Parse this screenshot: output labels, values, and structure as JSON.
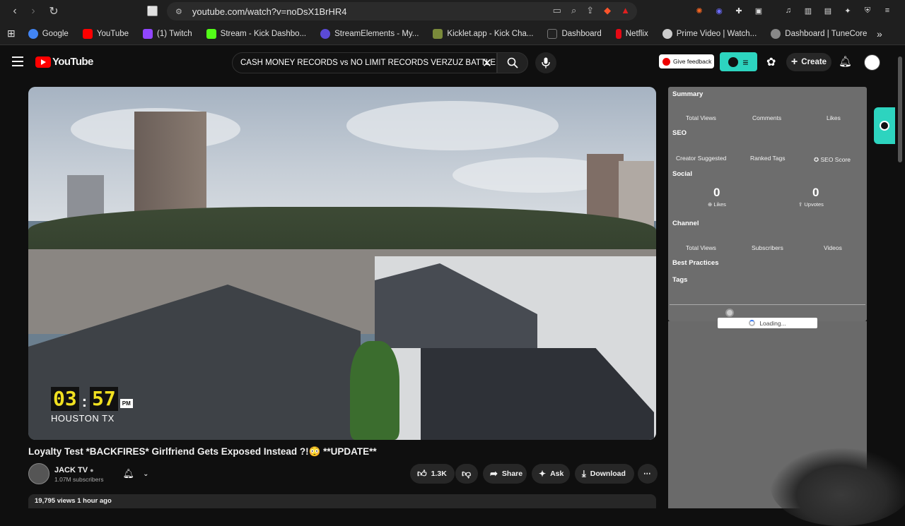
{
  "browser": {
    "url": "youtube.com/watch?v=noDsX1BrHR4",
    "bookmarks": [
      {
        "label": "Google",
        "color": "#4285f4"
      },
      {
        "label": "YouTube",
        "color": "#ff0000"
      },
      {
        "label": "(1) Twitch",
        "color": "#9146ff"
      },
      {
        "label": "Stream - Kick Dashbo...",
        "color": "#53fc18"
      },
      {
        "label": "StreamElements - My...",
        "color": "#5b4ad6"
      },
      {
        "label": "Kicklet.app - Kick Cha...",
        "color": "#7a8a3a"
      },
      {
        "label": "Dashboard",
        "color": "#222222"
      },
      {
        "label": "Netflix",
        "color": "#e50914"
      },
      {
        "label": "Prime Video | Watch...",
        "color": "#cccccc"
      },
      {
        "label": "Dashboard | TuneCore",
        "color": "#888888"
      }
    ]
  },
  "header": {
    "logo_text": "YouTube",
    "search_value": "CASH MONEY RECORDS vs NO LIMIT RECORDS VERZUZ BATTLE",
    "feedback_label": "Give feedback",
    "create_label": "Create"
  },
  "video": {
    "clock_hour": "03",
    "clock_minute": "57",
    "clock_ampm": "PM",
    "location": "HOUSTON TX",
    "title": "Loyalty Test *BACKFIRES* Girlfriend Gets Exposed Instead ?!😳 **UPDATE**",
    "channel_name": "JACK TV",
    "subscribers": "1.07M subscribers",
    "likes": "1.3K",
    "share_label": "Share",
    "ask_label": "Ask",
    "download_label": "Download",
    "views_line": "19,795 views  1 hour ago"
  },
  "panel": {
    "summary": "Summary",
    "total_views": "Total Views",
    "comments": "Comments",
    "likes": "Likes",
    "seo": "SEO",
    "creator_suggested": "Creator Suggested",
    "ranked_tags": "Ranked Tags",
    "seo_score": "SEO Score",
    "social": "Social",
    "social_likes_value": "0",
    "social_likes_label": "Likes",
    "upvotes_value": "0",
    "upvotes_label": "Upvotes",
    "channel": "Channel",
    "channel_total_views": "Total Views",
    "channel_subscribers": "Subscribers",
    "channel_videos": "Videos",
    "best_practices": "Best Practices",
    "tags": "Tags",
    "loading": "Loading..."
  },
  "colors": {
    "accent_teal": "#2dd4bf",
    "youtube_red": "#ff0000",
    "clock_yellow": "#f0e020"
  }
}
